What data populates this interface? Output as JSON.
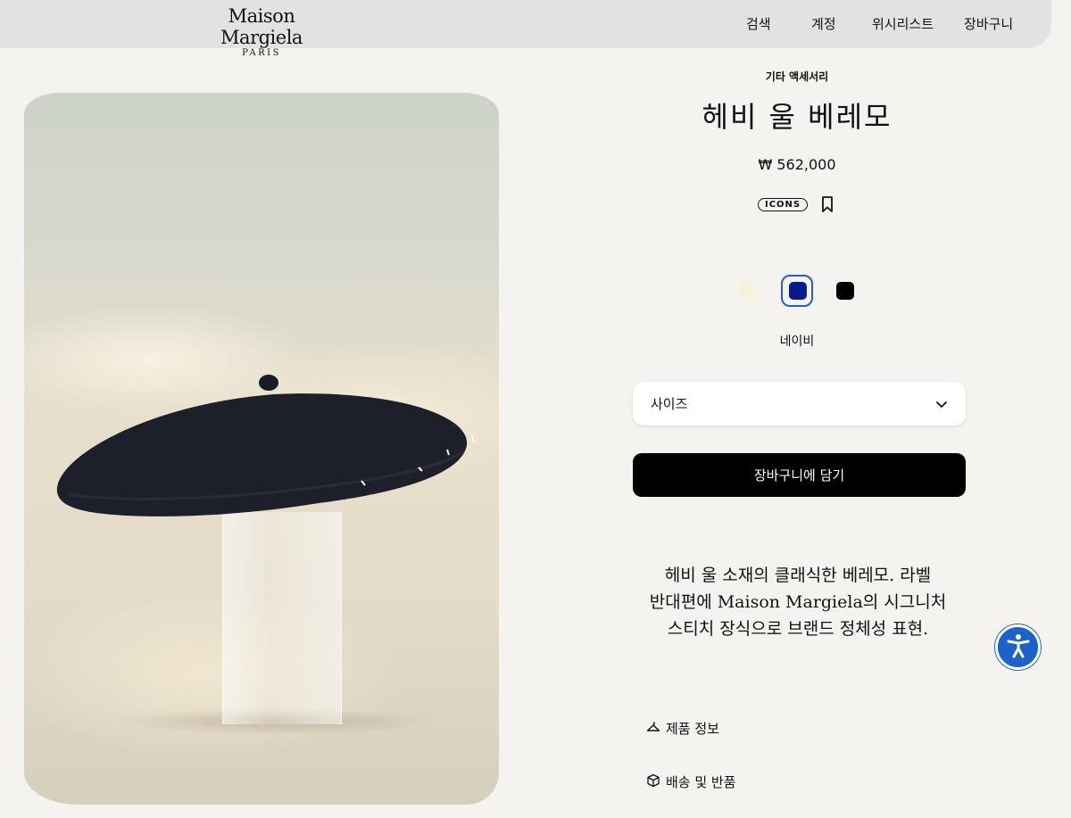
{
  "header": {
    "logo_main": "Maison Margiela",
    "logo_sub": "PARIS",
    "nav": [
      "검색",
      "계정",
      "위시리스트",
      "장바구니"
    ]
  },
  "product": {
    "category": "기타 액세서리",
    "title": "헤비 울 베레모",
    "price": "₩ 562,000",
    "badge": "ICONS",
    "colors": [
      {
        "name": "cream",
        "hex": "#f6f1dc"
      },
      {
        "name": "navy",
        "hex": "#0a1a86",
        "selected": true
      },
      {
        "name": "black",
        "hex": "#000000"
      }
    ],
    "selected_color_label": "네이비",
    "size_placeholder": "사이즈",
    "add_to_cart": "장바구니에 담기",
    "description_lines": [
      "헤비 울 소재의 클래식한 베레모. 라벨",
      "반대편에 Maison Margiela의 시그니처",
      "스티치 장식으로 브랜드 정체성 표현."
    ],
    "links": {
      "product_info": "제품 정보",
      "shipping_returns": "배송 및 반품"
    }
  },
  "colors": {
    "background": "#f4f3ef",
    "header": "#e2e2e0",
    "button": "#000000",
    "accessibility": "#1d62c8",
    "selected_outline": "#2a5bd7"
  }
}
